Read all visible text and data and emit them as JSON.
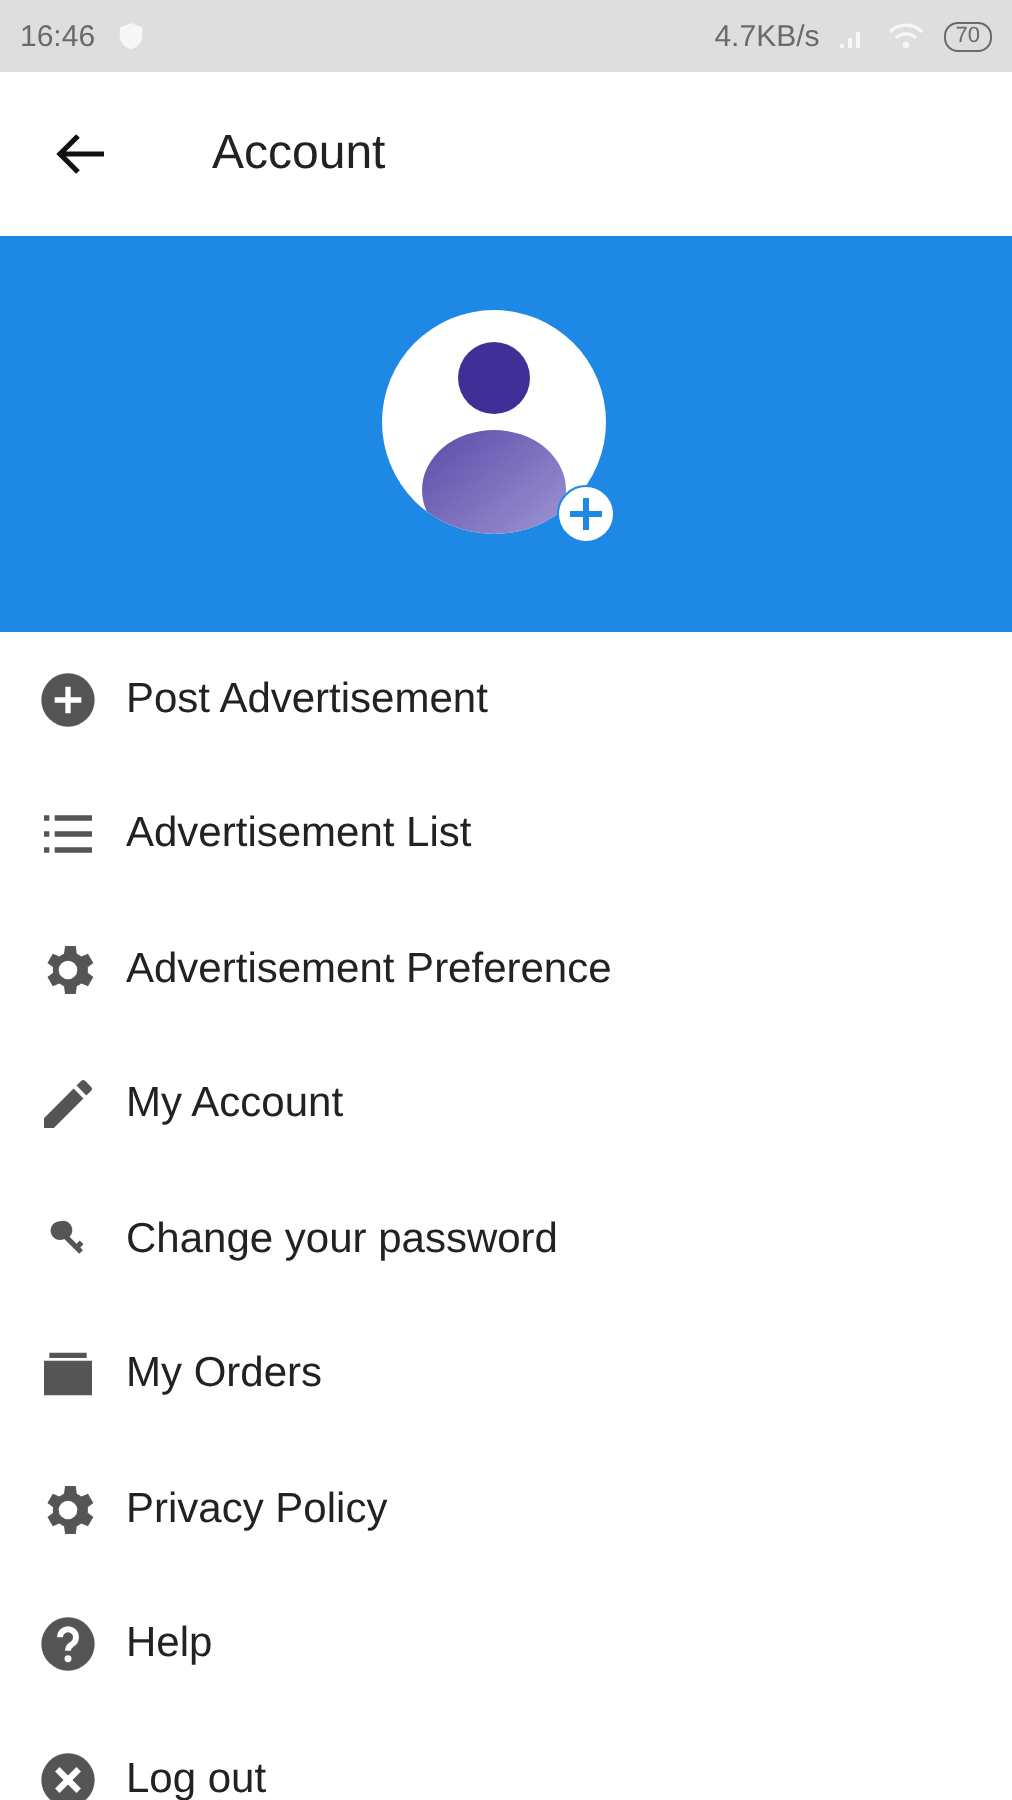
{
  "status_bar": {
    "time": "16:46",
    "speed": "4.7KB/s",
    "battery": "70"
  },
  "app_bar": {
    "title": "Account"
  },
  "menu": [
    {
      "kind": "add",
      "label": "Post Advertisement"
    },
    {
      "kind": "list",
      "label": "Advertisement List"
    },
    {
      "kind": "gear",
      "label": "Advertisement Preference"
    },
    {
      "kind": "pencil",
      "label": "My Account"
    },
    {
      "kind": "key",
      "label": "Change your password"
    },
    {
      "kind": "folder",
      "label": "My Orders"
    },
    {
      "kind": "gear",
      "label": "Privacy Policy"
    },
    {
      "kind": "help",
      "label": "Help"
    },
    {
      "kind": "close",
      "label": "Log out"
    }
  ]
}
